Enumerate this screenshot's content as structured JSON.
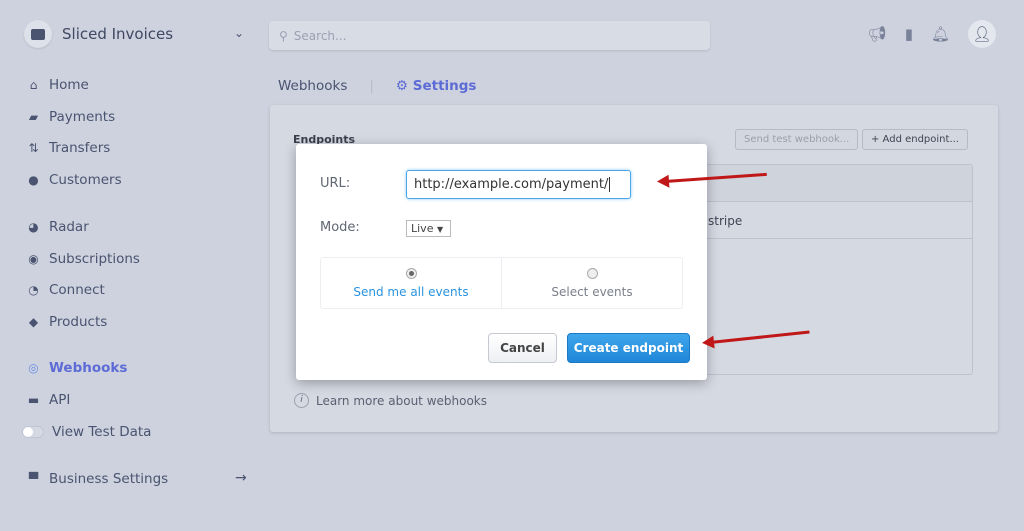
{
  "brand": {
    "name": "Sliced Invoices"
  },
  "search": {
    "placeholder": "Search..."
  },
  "sidebar": {
    "items": [
      {
        "label": "Home",
        "icon": "home-icon",
        "glyph": "⌂"
      },
      {
        "label": "Payments",
        "icon": "payments-icon",
        "glyph": "▰"
      },
      {
        "label": "Transfers",
        "icon": "transfers-icon",
        "glyph": "⇅"
      },
      {
        "label": "Customers",
        "icon": "customers-icon",
        "glyph": "●"
      },
      {
        "label": "Radar",
        "icon": "radar-icon",
        "glyph": "◕"
      },
      {
        "label": "Subscriptions",
        "icon": "subscriptions-icon",
        "glyph": "◉"
      },
      {
        "label": "Connect",
        "icon": "connect-icon",
        "glyph": "◔"
      },
      {
        "label": "Products",
        "icon": "products-icon",
        "glyph": "◆"
      },
      {
        "label": "Webhooks",
        "icon": "webhooks-icon",
        "glyph": "◎"
      },
      {
        "label": "API",
        "icon": "api-icon",
        "glyph": "▬"
      },
      {
        "label": "View Test Data"
      },
      {
        "label": "Business Settings",
        "icon": "store-icon",
        "glyph": "▀"
      }
    ]
  },
  "tabs": {
    "webhooks": "Webhooks",
    "settings": "Settings"
  },
  "card": {
    "title": "Endpoints",
    "send_test": "Send test webhook...",
    "add_endpoint": "+ Add endpoint...",
    "row_text": "r=stripe",
    "learn_more": "Learn more about webhooks"
  },
  "modal": {
    "url_label": "URL:",
    "url_value": "http://example.com/payment/",
    "mode_label": "Mode:",
    "mode_value": "Live",
    "all_events": "Send me all events",
    "select_events": "Select events",
    "cancel": "Cancel",
    "create": "Create endpoint"
  },
  "colors": {
    "accent": "#5d6bd6",
    "primary_button": "#2a93e0",
    "link": "#2a93e0",
    "annotation_arrow": "#c01818"
  }
}
